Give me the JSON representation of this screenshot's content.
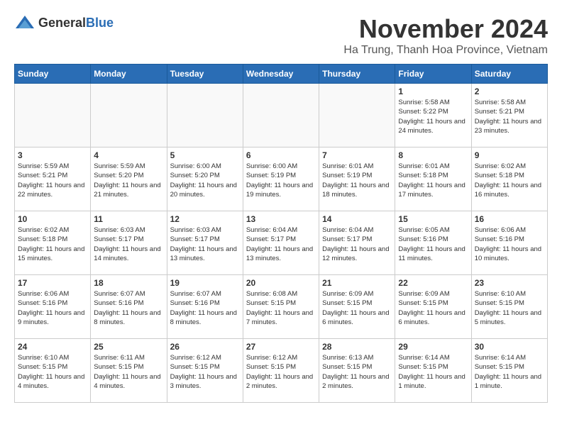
{
  "logo": {
    "general": "General",
    "blue": "Blue"
  },
  "header": {
    "month": "November 2024",
    "location": "Ha Trung, Thanh Hoa Province, Vietnam"
  },
  "weekdays": [
    "Sunday",
    "Monday",
    "Tuesday",
    "Wednesday",
    "Thursday",
    "Friday",
    "Saturday"
  ],
  "weeks": [
    [
      {
        "day": "",
        "sunrise": "",
        "sunset": "",
        "daylight": "",
        "empty": true
      },
      {
        "day": "",
        "sunrise": "",
        "sunset": "",
        "daylight": "",
        "empty": true
      },
      {
        "day": "",
        "sunrise": "",
        "sunset": "",
        "daylight": "",
        "empty": true
      },
      {
        "day": "",
        "sunrise": "",
        "sunset": "",
        "daylight": "",
        "empty": true
      },
      {
        "day": "",
        "sunrise": "",
        "sunset": "",
        "daylight": "",
        "empty": true
      },
      {
        "day": "1",
        "sunrise": "Sunrise: 5:58 AM",
        "sunset": "Sunset: 5:22 PM",
        "daylight": "Daylight: 11 hours and 24 minutes."
      },
      {
        "day": "2",
        "sunrise": "Sunrise: 5:58 AM",
        "sunset": "Sunset: 5:21 PM",
        "daylight": "Daylight: 11 hours and 23 minutes."
      }
    ],
    [
      {
        "day": "3",
        "sunrise": "Sunrise: 5:59 AM",
        "sunset": "Sunset: 5:21 PM",
        "daylight": "Daylight: 11 hours and 22 minutes."
      },
      {
        "day": "4",
        "sunrise": "Sunrise: 5:59 AM",
        "sunset": "Sunset: 5:20 PM",
        "daylight": "Daylight: 11 hours and 21 minutes."
      },
      {
        "day": "5",
        "sunrise": "Sunrise: 6:00 AM",
        "sunset": "Sunset: 5:20 PM",
        "daylight": "Daylight: 11 hours and 20 minutes."
      },
      {
        "day": "6",
        "sunrise": "Sunrise: 6:00 AM",
        "sunset": "Sunset: 5:19 PM",
        "daylight": "Daylight: 11 hours and 19 minutes."
      },
      {
        "day": "7",
        "sunrise": "Sunrise: 6:01 AM",
        "sunset": "Sunset: 5:19 PM",
        "daylight": "Daylight: 11 hours and 18 minutes."
      },
      {
        "day": "8",
        "sunrise": "Sunrise: 6:01 AM",
        "sunset": "Sunset: 5:18 PM",
        "daylight": "Daylight: 11 hours and 17 minutes."
      },
      {
        "day": "9",
        "sunrise": "Sunrise: 6:02 AM",
        "sunset": "Sunset: 5:18 PM",
        "daylight": "Daylight: 11 hours and 16 minutes."
      }
    ],
    [
      {
        "day": "10",
        "sunrise": "Sunrise: 6:02 AM",
        "sunset": "Sunset: 5:18 PM",
        "daylight": "Daylight: 11 hours and 15 minutes."
      },
      {
        "day": "11",
        "sunrise": "Sunrise: 6:03 AM",
        "sunset": "Sunset: 5:17 PM",
        "daylight": "Daylight: 11 hours and 14 minutes."
      },
      {
        "day": "12",
        "sunrise": "Sunrise: 6:03 AM",
        "sunset": "Sunset: 5:17 PM",
        "daylight": "Daylight: 11 hours and 13 minutes."
      },
      {
        "day": "13",
        "sunrise": "Sunrise: 6:04 AM",
        "sunset": "Sunset: 5:17 PM",
        "daylight": "Daylight: 11 hours and 13 minutes."
      },
      {
        "day": "14",
        "sunrise": "Sunrise: 6:04 AM",
        "sunset": "Sunset: 5:17 PM",
        "daylight": "Daylight: 11 hours and 12 minutes."
      },
      {
        "day": "15",
        "sunrise": "Sunrise: 6:05 AM",
        "sunset": "Sunset: 5:16 PM",
        "daylight": "Daylight: 11 hours and 11 minutes."
      },
      {
        "day": "16",
        "sunrise": "Sunrise: 6:06 AM",
        "sunset": "Sunset: 5:16 PM",
        "daylight": "Daylight: 11 hours and 10 minutes."
      }
    ],
    [
      {
        "day": "17",
        "sunrise": "Sunrise: 6:06 AM",
        "sunset": "Sunset: 5:16 PM",
        "daylight": "Daylight: 11 hours and 9 minutes."
      },
      {
        "day": "18",
        "sunrise": "Sunrise: 6:07 AM",
        "sunset": "Sunset: 5:16 PM",
        "daylight": "Daylight: 11 hours and 8 minutes."
      },
      {
        "day": "19",
        "sunrise": "Sunrise: 6:07 AM",
        "sunset": "Sunset: 5:16 PM",
        "daylight": "Daylight: 11 hours and 8 minutes."
      },
      {
        "day": "20",
        "sunrise": "Sunrise: 6:08 AM",
        "sunset": "Sunset: 5:15 PM",
        "daylight": "Daylight: 11 hours and 7 minutes."
      },
      {
        "day": "21",
        "sunrise": "Sunrise: 6:09 AM",
        "sunset": "Sunset: 5:15 PM",
        "daylight": "Daylight: 11 hours and 6 minutes."
      },
      {
        "day": "22",
        "sunrise": "Sunrise: 6:09 AM",
        "sunset": "Sunset: 5:15 PM",
        "daylight": "Daylight: 11 hours and 6 minutes."
      },
      {
        "day": "23",
        "sunrise": "Sunrise: 6:10 AM",
        "sunset": "Sunset: 5:15 PM",
        "daylight": "Daylight: 11 hours and 5 minutes."
      }
    ],
    [
      {
        "day": "24",
        "sunrise": "Sunrise: 6:10 AM",
        "sunset": "Sunset: 5:15 PM",
        "daylight": "Daylight: 11 hours and 4 minutes."
      },
      {
        "day": "25",
        "sunrise": "Sunrise: 6:11 AM",
        "sunset": "Sunset: 5:15 PM",
        "daylight": "Daylight: 11 hours and 4 minutes."
      },
      {
        "day": "26",
        "sunrise": "Sunrise: 6:12 AM",
        "sunset": "Sunset: 5:15 PM",
        "daylight": "Daylight: 11 hours and 3 minutes."
      },
      {
        "day": "27",
        "sunrise": "Sunrise: 6:12 AM",
        "sunset": "Sunset: 5:15 PM",
        "daylight": "Daylight: 11 hours and 2 minutes."
      },
      {
        "day": "28",
        "sunrise": "Sunrise: 6:13 AM",
        "sunset": "Sunset: 5:15 PM",
        "daylight": "Daylight: 11 hours and 2 minutes."
      },
      {
        "day": "29",
        "sunrise": "Sunrise: 6:14 AM",
        "sunset": "Sunset: 5:15 PM",
        "daylight": "Daylight: 11 hours and 1 minute."
      },
      {
        "day": "30",
        "sunrise": "Sunrise: 6:14 AM",
        "sunset": "Sunset: 5:15 PM",
        "daylight": "Daylight: 11 hours and 1 minute."
      }
    ]
  ]
}
